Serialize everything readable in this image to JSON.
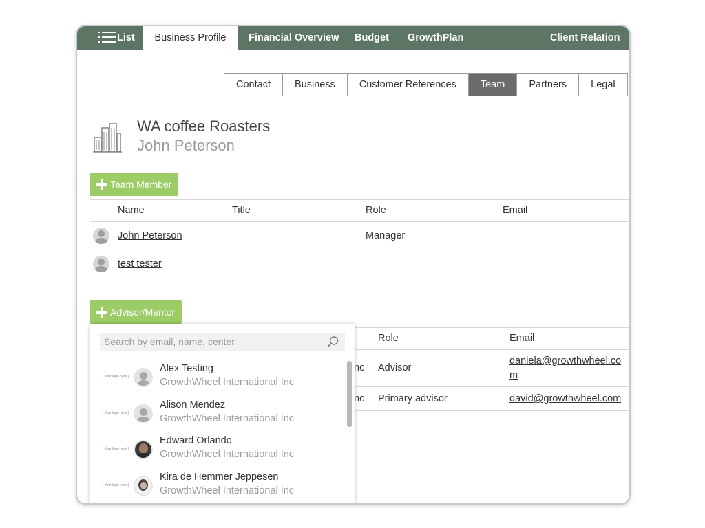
{
  "topnav": {
    "list_label": "List",
    "tabs": [
      "Business Profile",
      "Financial Overview",
      "Budget",
      "GrowthPlan",
      "Client Relation"
    ]
  },
  "subtabs": [
    "Contact",
    "Business",
    "Customer References",
    "Team",
    "Partners",
    "Legal"
  ],
  "header": {
    "company": "WA coffee Roasters",
    "person": "John Peterson"
  },
  "team": {
    "add_label": "Team Member",
    "columns": [
      "Name",
      "Title",
      "Role",
      "Email"
    ],
    "rows": [
      {
        "name": "John Peterson",
        "title": "",
        "role": "Manager",
        "email": ""
      },
      {
        "name": "test tester",
        "title": "",
        "role": "",
        "email": ""
      }
    ]
  },
  "advisors": {
    "add_label": "Advisor/Mentor",
    "columns": [
      "Role",
      "Email"
    ],
    "rows": [
      {
        "org_fragment": "nc",
        "role": "Advisor",
        "email_line1": "daniela@growthwheel.co",
        "email_line2": "m"
      },
      {
        "org_fragment": "nc",
        "role": "Primary advisor",
        "email_line1": "david@growthwheel.com",
        "email_line2": ""
      }
    ]
  },
  "search": {
    "placeholder": "Search by email, name, center",
    "tag": "[ Your logo here ]",
    "results": [
      {
        "name": "Alex Testing",
        "org": "GrowthWheel International Inc",
        "avatar": "gray"
      },
      {
        "name": "Alison Mendez",
        "org": "GrowthWheel International Inc",
        "avatar": "gray"
      },
      {
        "name": "Edward Orlando",
        "org": "GrowthWheel International Inc",
        "avatar": "photo1"
      },
      {
        "name": "Kira de Hemmer Jeppesen",
        "org": "GrowthWheel International Inc",
        "avatar": "photo2"
      }
    ]
  },
  "colors": {
    "nav_bg": "#5d7565",
    "accent_green": "#9ccc65",
    "active_subtab": "#6b6b6b"
  }
}
